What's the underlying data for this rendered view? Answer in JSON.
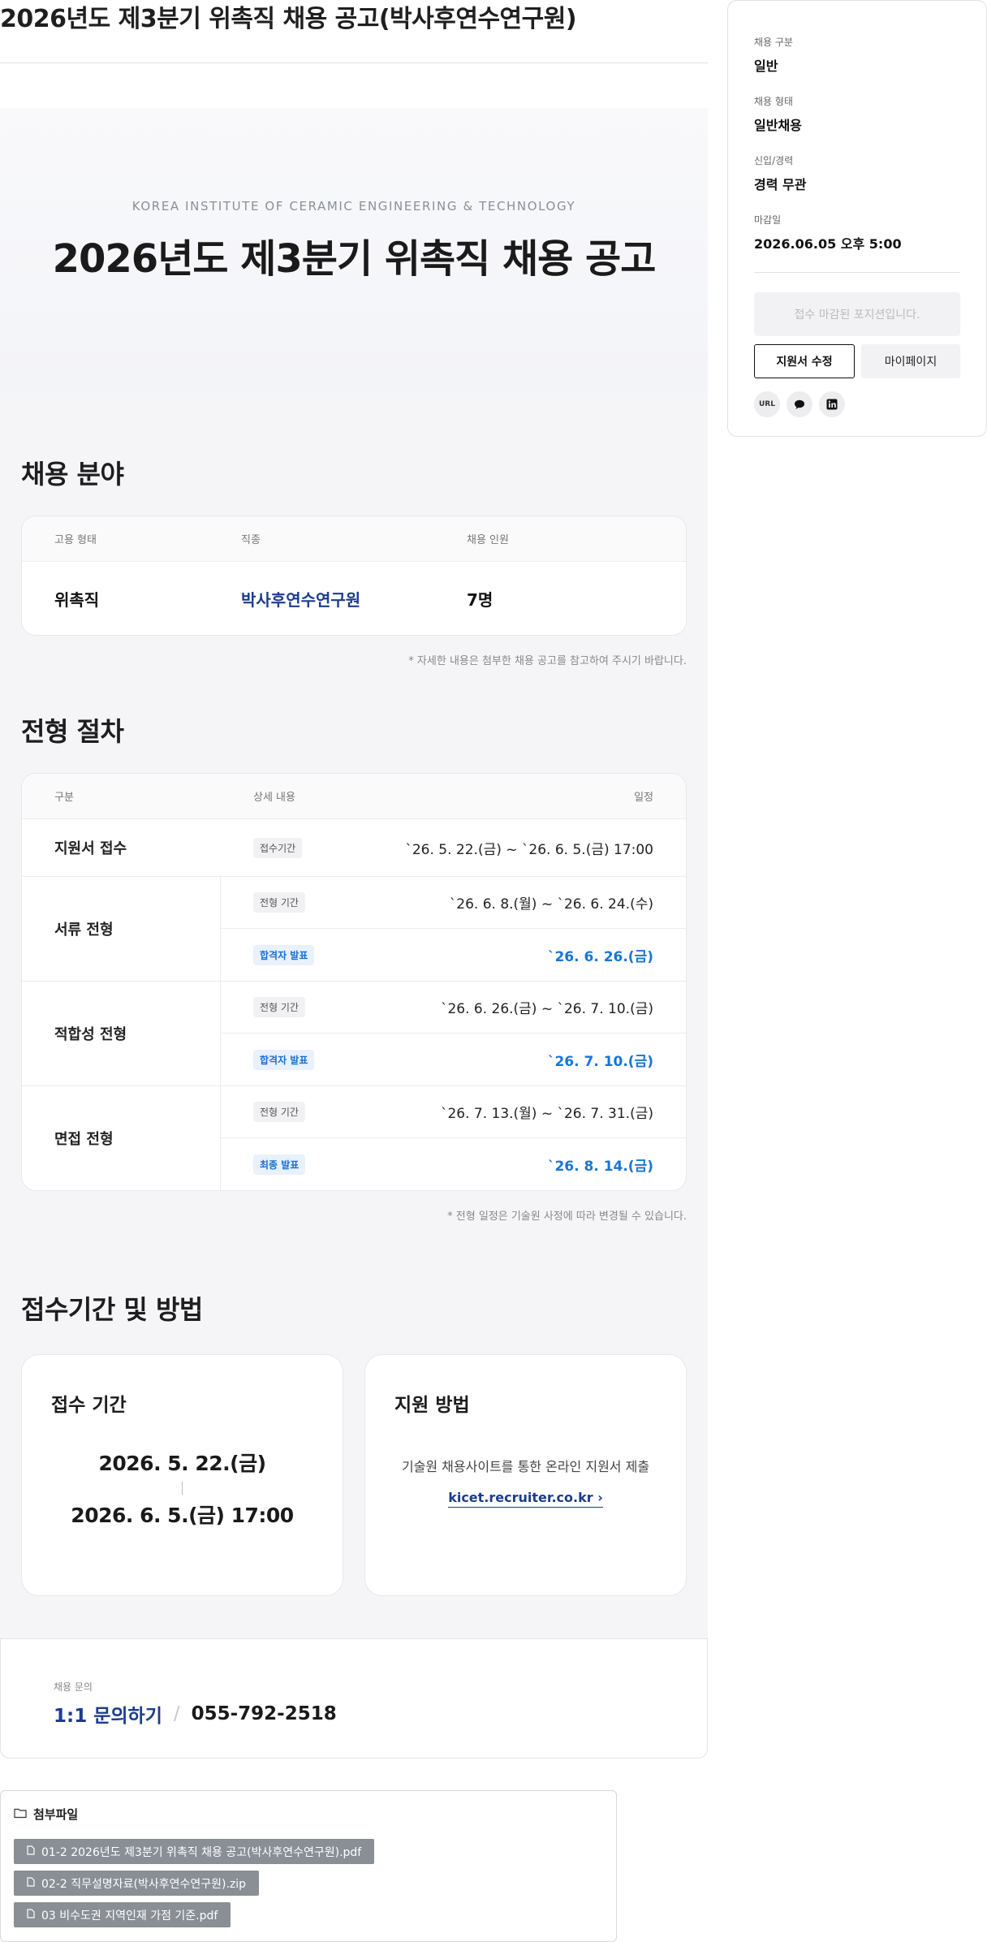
{
  "page_title": "2026년도 제3분기 위촉직 채용 공고(박사후연수연구원)",
  "hero": {
    "subtitle": "KOREA INSTITUTE OF CERAMIC ENGINEERING & TECHNOLOGY",
    "title": "2026년도 제3분기 위촉직 채용 공고"
  },
  "recruit": {
    "title": "채용 분야",
    "headers": [
      "고용 형태",
      "직종",
      "채용 인원"
    ],
    "row": {
      "type": "위촉직",
      "job": "박사후연수연구원",
      "count": "7명"
    },
    "note": "* 자세한 내용은 첨부한 채용 공고를 참고하여 주시기 바랍니다.",
    "job_color": "#1c3c8c"
  },
  "process": {
    "title": "전형 절차",
    "headers": [
      "구분",
      "상세 내용",
      "일정"
    ],
    "apply": {
      "name": "지원서 접수",
      "badge": "접수기간",
      "date": "`26. 5. 22.(금) ~ `26. 6. 5.(금) 17:00"
    },
    "docs": {
      "name": "서류 전형",
      "rows": [
        {
          "badge": "전형 기간",
          "date": "`26. 6. 8.(월) ~ `26. 6. 24.(수)"
        },
        {
          "badge": "합격자 발표",
          "date": "`26. 6. 26.(금)"
        }
      ]
    },
    "fit": {
      "name": "적합성 전형",
      "rows": [
        {
          "badge": "전형 기간",
          "date": "`26. 6. 26.(금) ~ `26. 7. 10.(금)"
        },
        {
          "badge": "합격자 발표",
          "date": "`26. 7. 10.(금)"
        }
      ]
    },
    "interview": {
      "name": "면접 전형",
      "rows": [
        {
          "badge": "전형 기간",
          "date": "`26. 7. 13.(월) ~ `26. 7. 31.(금)"
        },
        {
          "badge": "최종 발표",
          "date": "`26. 8. 14.(금)"
        }
      ]
    },
    "note": "* 전형 일정은 기술원 사정에 따라 변경될 수 있습니다.",
    "accent_color": "#1b74d6"
  },
  "application": {
    "title": "접수기간 및 방법",
    "period_title": "접수 기간",
    "period_start": "2026. 5. 22.(금)",
    "period_end": "2026. 6. 5.(금) 17:00",
    "method_title": "지원 방법",
    "method_text": "기술원 채용사이트를 통한 온라인 지원서 제출",
    "method_link": "kicet.recruiter.co.kr ›"
  },
  "contact": {
    "label": "채용 문의",
    "inquiry": "1:1 문의하기",
    "phone": "055-792-2518"
  },
  "attachments": {
    "title": "첨부파일",
    "files": [
      "01-2 2026년도 제3분기 위촉직 채용 공고(박사후연수연구원).pdf",
      "02-2 직무설명자료(박사후연수연구원).zip",
      "03 비수도권 지역인재 가점 기준.pdf"
    ]
  },
  "sidebar": {
    "items": [
      {
        "label": "채용 구분",
        "value": "일반"
      },
      {
        "label": "채용 형태",
        "value": "일반채용"
      },
      {
        "label": "신입/경력",
        "value": "경력 무관"
      },
      {
        "label": "마감일",
        "value": "2026.06.05 오후 5:00"
      }
    ],
    "closed_label": "접수 마감된 포지션입니다.",
    "edit_label": "지원서 수정",
    "mypage_label": "마이페이지",
    "share_url_label": "URL",
    "share_icons": [
      "chat-icon",
      "linkedin-icon"
    ]
  }
}
